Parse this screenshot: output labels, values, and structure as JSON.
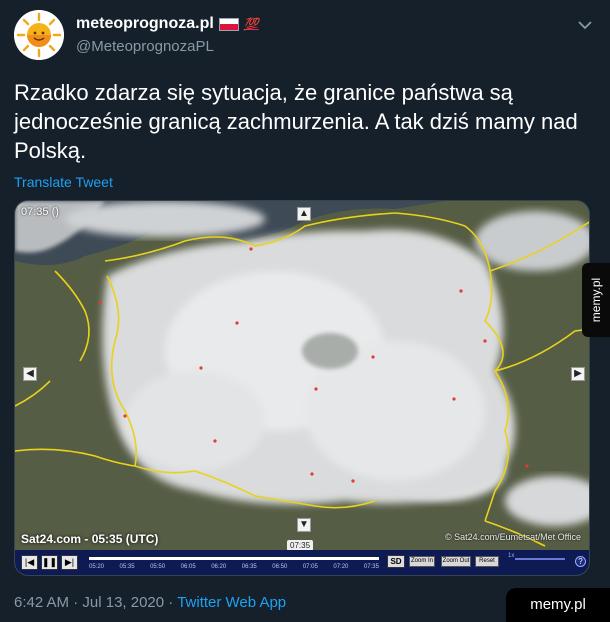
{
  "colors": {
    "background": "#15202b",
    "link": "#1da1f2",
    "muted": "#8899a6",
    "text": "#ffffff",
    "accent_red": "#e0245e"
  },
  "account": {
    "display_name": "meteoprognoza.pl",
    "handle": "@MeteoprognozaPL",
    "badges": [
      "poland-flag-icon",
      "hundred-points-icon"
    ],
    "hundred_glyph": "💯"
  },
  "tweet": {
    "text": "Rzadko zdarza się sytuacja, że granice państwa są jednocześnie granicą zachmurzenia. A tak dziś mamy nad Polską.",
    "translate_label": "Translate Tweet",
    "time": "6:42 AM",
    "date": "Jul 13, 2020",
    "app": "Twitter Web App"
  },
  "media": {
    "corner_time": "07:35 ()",
    "source_label": "Sat24.com - 05:35 (UTC)",
    "credit": "© Sat24.com/Eumetsat/Met Office",
    "current_time_bubble": "07:35",
    "timeline_ticks": [
      "05:20",
      "05:35",
      "05:50",
      "06:05",
      "06:20",
      "06:35",
      "06:50",
      "07:05",
      "07:20",
      "07:35"
    ],
    "timeline_progress": 1.0,
    "buttons": {
      "prev": "|◀",
      "pause": "❚❚",
      "next": "▶|",
      "sd": "SD",
      "zoom_in": "Zoom In",
      "zoom_out": "Zoom Out",
      "reset": "Reset",
      "speed": "1x",
      "help": "?"
    },
    "nav": {
      "up": "▲",
      "down": "▼",
      "left": "◀",
      "right": "▶"
    }
  },
  "watermark": {
    "side": "memy.pl",
    "bottom": "memy.pl"
  }
}
